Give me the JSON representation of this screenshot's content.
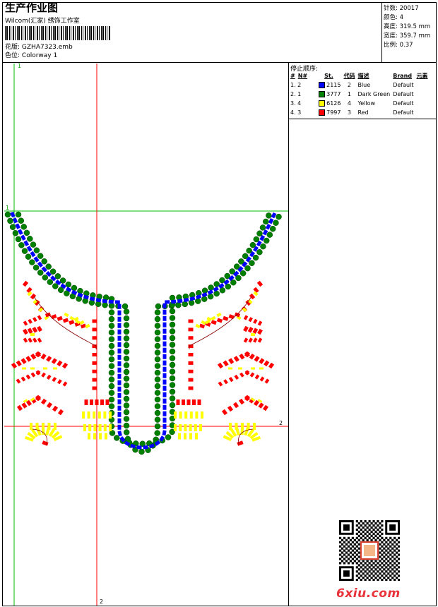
{
  "header": {
    "title": "生产作业图",
    "company": "Wilcom(汇家) 绣饰工作室",
    "file_label": "花版:",
    "file_value": "GZHA7323.emb",
    "colorway_label": "色位:",
    "colorway_value": "Colorway 1"
  },
  "meta": [
    {
      "label": "针数:",
      "value": "20017"
    },
    {
      "label": "颜色:",
      "value": "4"
    },
    {
      "label": "高度:",
      "value": "319.5 mm"
    },
    {
      "label": "宽度:",
      "value": "359.7 mm"
    },
    {
      "label": "比例:",
      "value": "0.37"
    }
  ],
  "stop_sequence": {
    "title": "停止顺序:",
    "headers": [
      "#",
      "N#",
      "St.",
      "代码",
      "描述",
      "Brand",
      "元素"
    ],
    "rows": [
      {
        "idx": "1. 2",
        "st": "2115",
        "code": "2",
        "desc": "Blue",
        "brand": "Default",
        "color": "#0000ff"
      },
      {
        "idx": "2. 1",
        "st": "3777",
        "code": "1",
        "desc": "Dark Green",
        "brand": "Default",
        "color": "#008000"
      },
      {
        "idx": "3. 4",
        "st": "6126",
        "code": "4",
        "desc": "Yellow",
        "brand": "Default",
        "color": "#ffff00"
      },
      {
        "idx": "4. 3",
        "st": "7997",
        "code": "3",
        "desc": "Red",
        "brand": "Default",
        "color": "#ff0000"
      }
    ]
  },
  "guides": {
    "v1": "1",
    "h1": "1",
    "h2": "2",
    "v2": "2"
  },
  "watermark": {
    "site": "6xiu.com"
  },
  "colors": {
    "guide_green": "#00c000",
    "guide_red": "#ff0000",
    "thread_blue": "#0000ff",
    "thread_green": "#008000",
    "thread_yellow": "#ffff00",
    "thread_red": "#ff0000"
  }
}
